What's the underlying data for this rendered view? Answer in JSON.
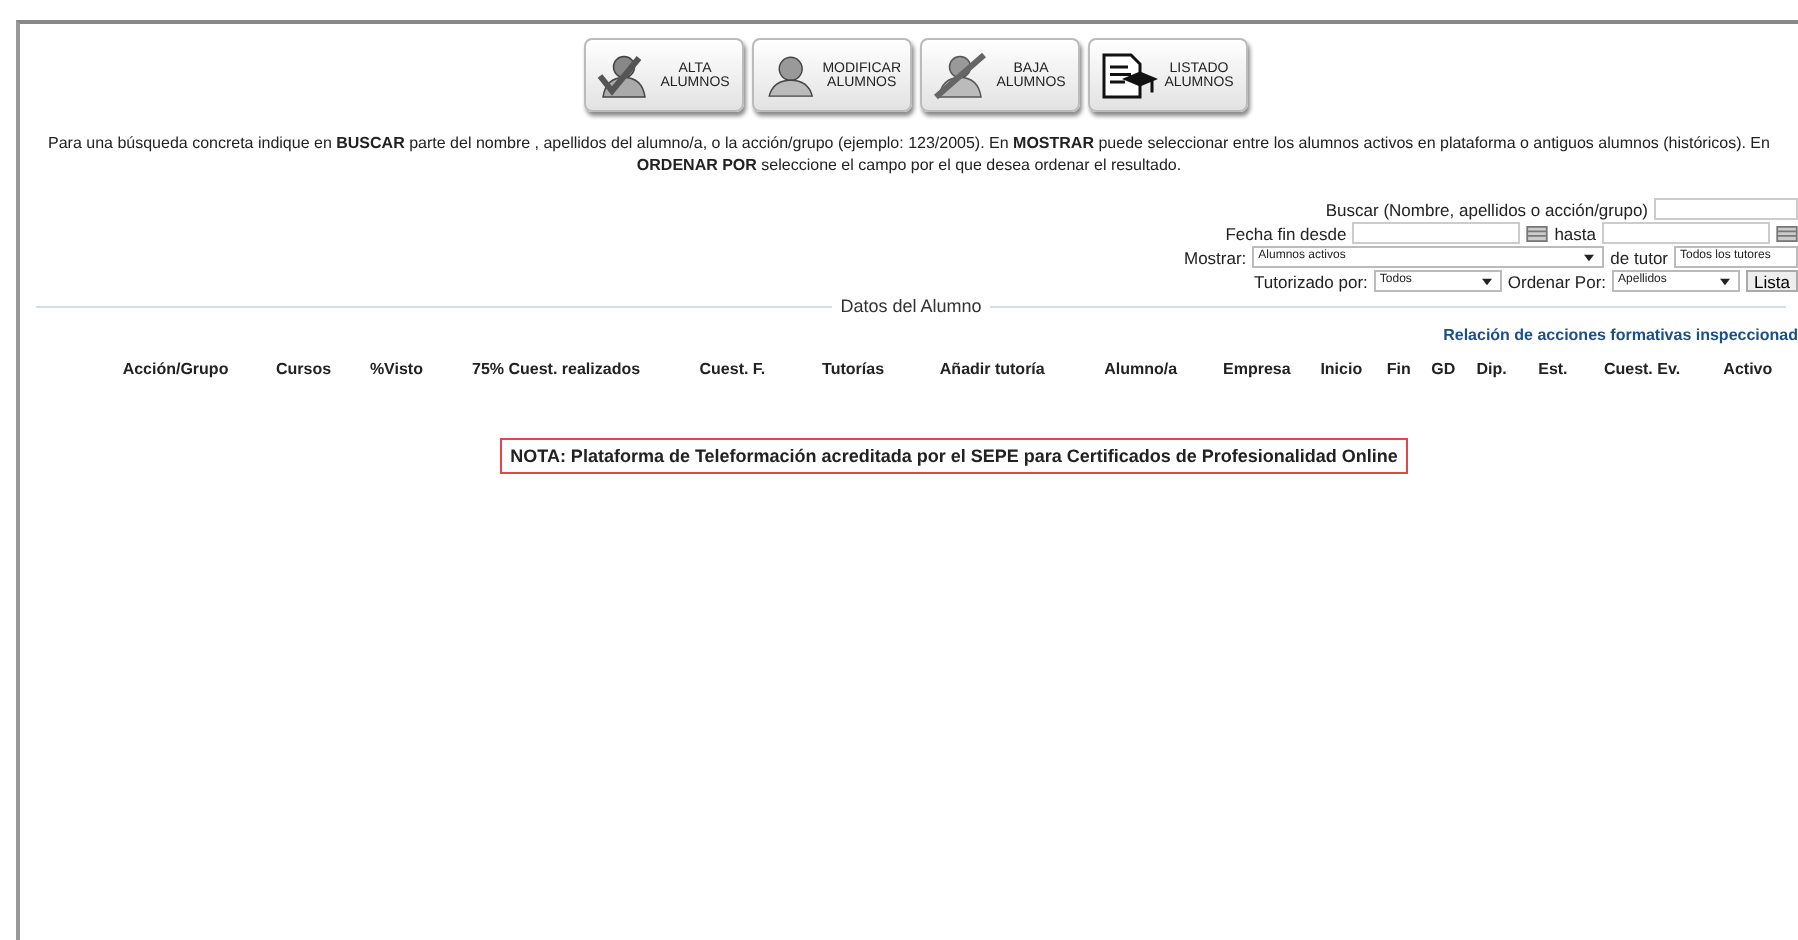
{
  "toolbar": [
    {
      "lines": [
        "ALTA",
        "ALUMNOS"
      ]
    },
    {
      "lines": [
        "MODIFICAR",
        "ALUMNOS"
      ]
    },
    {
      "lines": [
        "BAJA",
        "ALUMNOS"
      ]
    },
    {
      "lines": [
        "LISTADO",
        "ALUMNOS"
      ]
    }
  ],
  "help": [
    "Para una búsqueda concreta indique en **BUSCAR** parte del nombre , apellidos del alumno/a, o la acción/grupo (ejemplo: 123/2005). En **MOSTRAR** puede seleccionar entre los alumnos activos en plataforma o antiguos alumnos (históricos). En",
    "**ORDENAR POR** seleccione el campo por el que desea ordenar el resultado."
  ],
  "filters": {
    "search_label": "Buscar (Nombre, apellidos o acción/grupo)",
    "date_from_label": "Fecha fin desde",
    "date_to_label": "hasta",
    "show_label": "Mostrar:",
    "show_value": "Alumnos activos",
    "tutor_label": "de tutor",
    "tutor_value": "Todos los tutores",
    "tutored_label": "Tutorizado por:",
    "tutored_value": "Todos",
    "order_label": "Ordenar Por:",
    "order_value": "Apellidos",
    "list_button": "Lista"
  },
  "section_title": "Datos del Alumno",
  "report_link": "Relación de acciones formativas inspeccionad",
  "columns": [
    "Acción/Grupo",
    "Cursos",
    "%Visto",
    "75% Cuest. realizados",
    "Cuest. F.",
    "Tutorías",
    "Añadir tutoría",
    "Alumno/a",
    "Empresa",
    "Inicio",
    "Fin",
    "GD",
    "Dip.",
    "Est.",
    "Cuest. Ev.",
    "Activo"
  ],
  "note": "NOTA: Plataforma de Teleformación acreditada por el SEPE para Certificados de Profesionalidad Online"
}
